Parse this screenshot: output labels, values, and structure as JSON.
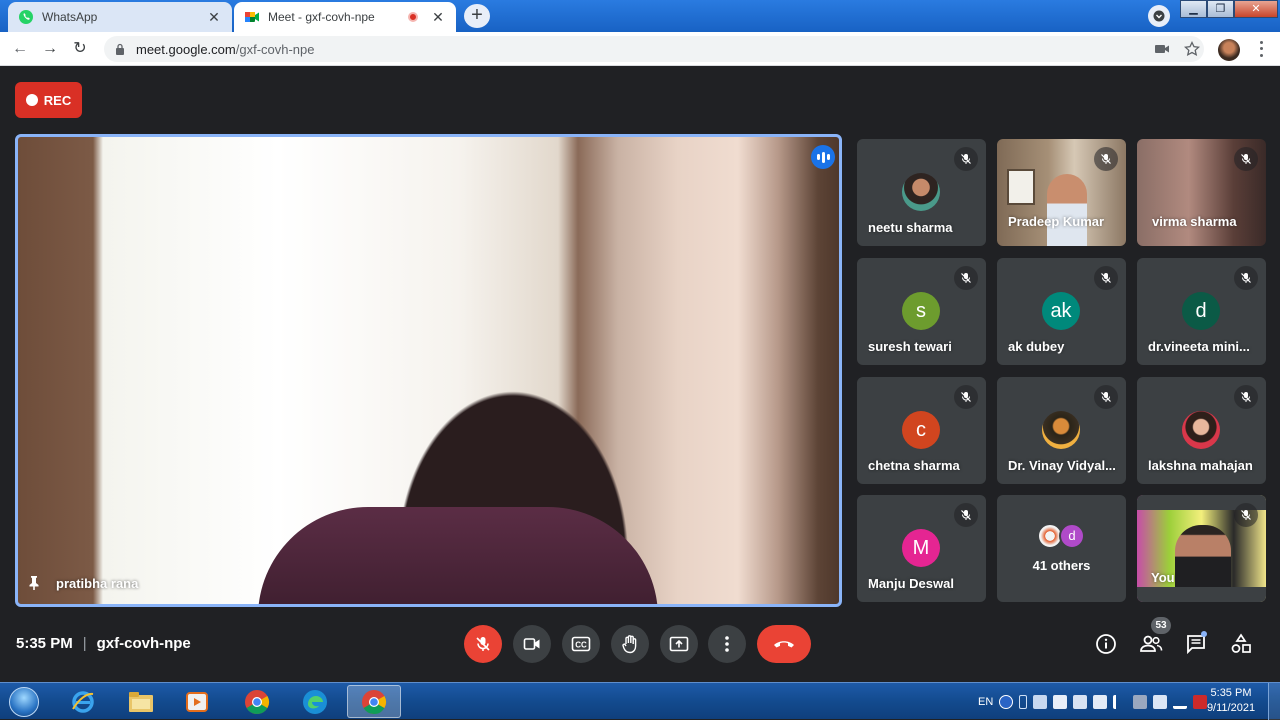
{
  "browser": {
    "tabs": [
      {
        "title": "WhatsApp",
        "active": false
      },
      {
        "title": "Meet - gxf-covh-npe",
        "active": true
      }
    ],
    "url_host": "meet.google.com",
    "url_path": "/gxf-covh-npe"
  },
  "meeting": {
    "rec_label": "REC",
    "time": "5:35 PM",
    "separator": "|",
    "code": "gxf-covh-npe",
    "participant_count": "53",
    "main_speaker": "pratibha rana",
    "others_label": "41 others"
  },
  "participants": [
    {
      "name": "neetu sharma",
      "initial": "",
      "kind": "photo"
    },
    {
      "name": "Pradeep Kumar",
      "initial": "",
      "kind": "video"
    },
    {
      "name": "virma sharma",
      "initial": "",
      "kind": "video"
    },
    {
      "name": "suresh tewari",
      "initial": "s",
      "kind": "initial",
      "color": "#6d9c2e"
    },
    {
      "name": "ak dubey",
      "initial": "ak",
      "kind": "initial",
      "color": "#00897b"
    },
    {
      "name": "dr.vineeta mini...",
      "initial": "d",
      "kind": "initial",
      "color": "#0b5a46"
    },
    {
      "name": "chetna sharma",
      "initial": "c",
      "kind": "initial",
      "color": "#d1451f"
    },
    {
      "name": "Dr. Vinay Vidyal...",
      "initial": "",
      "kind": "photo"
    },
    {
      "name": "lakshna mahajan",
      "initial": "",
      "kind": "photo"
    },
    {
      "name": "Manju Deswal",
      "initial": "M",
      "kind": "initial",
      "color": "#e52592"
    },
    {
      "name": "You",
      "initial": "",
      "kind": "video"
    }
  ],
  "others_avatar_initial": "d",
  "taskbar": {
    "lang": "EN",
    "clock_time": "5:35 PM",
    "clock_date": "9/11/2021"
  }
}
